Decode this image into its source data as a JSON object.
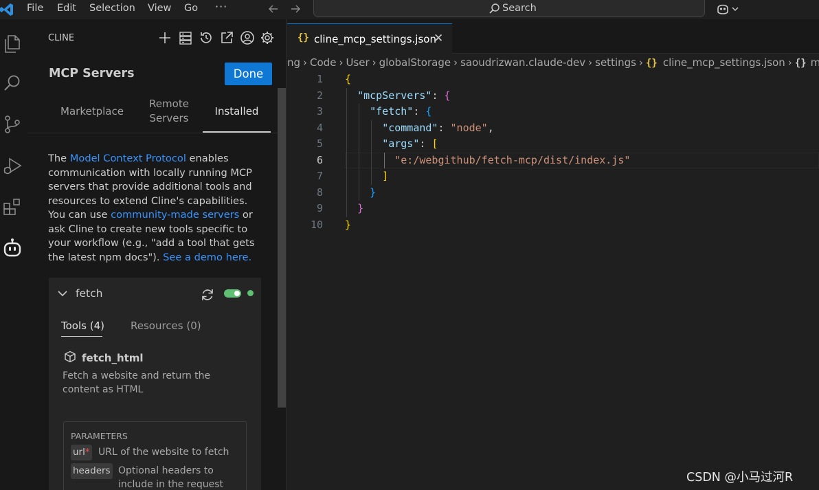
{
  "titlebar": {
    "menu": [
      "File",
      "Edit",
      "Selection",
      "View",
      "Go"
    ],
    "more": "···",
    "search_label": "Search"
  },
  "panel": {
    "title": "CLINE",
    "heading": "MCP Servers",
    "done_label": "Done",
    "tabs": [
      {
        "label": "Marketplace"
      },
      {
        "label": "Remote Servers"
      },
      {
        "label": "Installed"
      }
    ],
    "description": {
      "p1": "The ",
      "link1": "Model Context Protocol",
      "p2": " enables communication with locally running MCP servers that provide additional tools and resources to extend Cline's capabilities. You can use ",
      "link2": "community-made servers",
      "p3": " or ask Cline to create new tools specific to your workflow (e.g., \"add a tool that gets the latest npm docs\"). ",
      "link3": "See a demo here."
    },
    "server": {
      "name": "fetch",
      "tabs": [
        "Tools (4)",
        "Resources (0)"
      ],
      "tool": {
        "name": "fetch_html",
        "description": "Fetch a website and return the content as HTML",
        "params_title": "PARAMETERS",
        "params": [
          {
            "name": "url",
            "required": "*",
            "description": "URL of the website to fetch"
          },
          {
            "name": "headers",
            "required": "",
            "description": "Optional headers to include in the request"
          }
        ]
      }
    }
  },
  "editor": {
    "tab_icon": "{}",
    "tab_name": "cline_mcp_settings.json",
    "tab_close": "✕",
    "breadcrumb": [
      "ng",
      "Code",
      "User",
      "globalStorage",
      "saoudrizwan.claude-dev",
      "settings",
      "cline_mcp_settings.json",
      "m"
    ],
    "line_numbers": [
      "1",
      "2",
      "3",
      "4",
      "5",
      "6",
      "7",
      "8",
      "9",
      "10"
    ],
    "current_line": 6,
    "code": {
      "l1": "{",
      "l2_key": "\"mcpServers\"",
      "l3_key": "\"fetch\"",
      "l4_key": "\"command\"",
      "l4_val": "\"node\"",
      "l5_key": "\"args\"",
      "l6_val": "\"e:/webgithub/fetch-mcp/dist/index.js\"",
      "colon": ": ",
      "comma": ",",
      "open_brace": "{",
      "close_brace": "}",
      "open_bracket": "[",
      "close_bracket": "]"
    }
  },
  "watermark": "CSDN @小马过河R",
  "colors": {
    "accent": "#0e78d4",
    "link": "#3794ff",
    "toggle_on": "#5fbf73",
    "json_key": "#9cdcfe",
    "json_string": "#ce9178"
  }
}
